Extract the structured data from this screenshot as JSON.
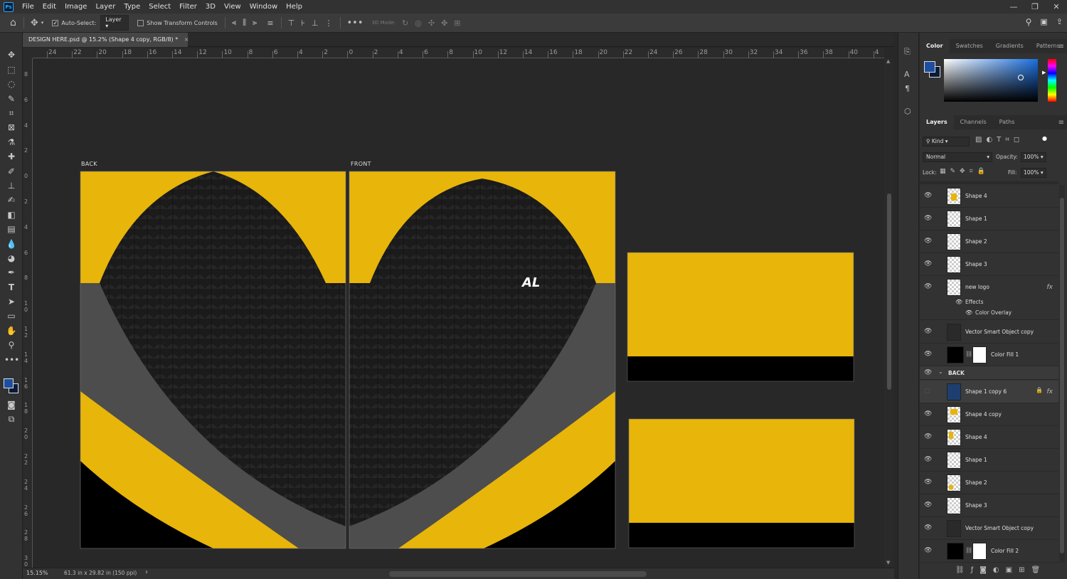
{
  "menu": [
    "File",
    "Edit",
    "Image",
    "Layer",
    "Type",
    "Select",
    "Filter",
    "3D",
    "View",
    "Window",
    "Help"
  ],
  "window_controls": [
    "—",
    "❐",
    "✕"
  ],
  "options": {
    "auto_select_label": "Auto-Select:",
    "auto_select_value": "Layer",
    "transform_label": "Show Transform Controls",
    "mode_3d_label": "3D Mode:"
  },
  "document": {
    "tab_title": "DESIGN HERE.psd @ 15.2% (Shape 4 copy, RGB/8) *",
    "close": "×"
  },
  "ruler_h_ticks": [
    "24",
    "22",
    "20",
    "18",
    "16",
    "14",
    "12",
    "10",
    "8",
    "6",
    "4",
    "2",
    "0",
    "2",
    "4",
    "6",
    "8",
    "10",
    "12",
    "14",
    "16",
    "18",
    "20",
    "22",
    "24",
    "26",
    "28",
    "30",
    "32",
    "34",
    "36",
    "38",
    "40",
    "4"
  ],
  "ruler_v_ticks": [
    "8",
    "6",
    "4",
    "2",
    "0",
    "2",
    "4",
    "6",
    "8",
    "1\n0",
    "1\n2",
    "1\n4",
    "1\n6",
    "1\n8",
    "2\n0",
    "2\n2",
    "2\n4",
    "2\n6",
    "2\n8",
    "3\n0"
  ],
  "canvas": {
    "back_label": "BACK",
    "front_label": "FRONT",
    "logo_text": "AL"
  },
  "status": {
    "zoom": "15.15%",
    "dimensions": "61.3 in x 29.82 in (150 ppi)",
    "arrow": "›"
  },
  "color_panel": {
    "tabs": [
      "Color",
      "Swatches",
      "Gradients",
      "Patterns"
    ],
    "fg": "#1e4ea0",
    "bg": "#0a1a3a"
  },
  "layers_panel": {
    "tabs": [
      "Layers",
      "Channels",
      "Paths"
    ],
    "kind_label": "Kind",
    "blend_mode": "Normal",
    "opacity_label": "Opacity:",
    "opacity_value": "100%",
    "lock_label": "Lock:",
    "fill_label": "Fill:",
    "fill_value": "100%",
    "layers": [
      {
        "name": "Shape 4",
        "fx": "",
        "thumb": "#e8b50a"
      },
      {
        "name": "Shape 1",
        "fx": "",
        "thumb": ""
      },
      {
        "name": "Shape 2",
        "fx": "",
        "thumb": ""
      },
      {
        "name": "Shape 3",
        "fx": "",
        "thumb": ""
      },
      {
        "name": "new logo",
        "fx": "fx",
        "thumb": ""
      }
    ],
    "effects_label": "Effects",
    "color_overlay_label": "Color Overlay",
    "layers2": [
      {
        "name": "Vector Smart Object copy",
        "fx": ""
      },
      {
        "name": "Color Fill 1",
        "fx": ""
      }
    ],
    "group_name": "BACK",
    "layers3": [
      {
        "name": "Shape 1 copy 6",
        "fx": "fx"
      },
      {
        "name": "Shape 4 copy",
        "fx": ""
      },
      {
        "name": "Shape 4",
        "fx": ""
      },
      {
        "name": "Shape 1",
        "fx": ""
      },
      {
        "name": "Shape 2",
        "fx": ""
      },
      {
        "name": "Shape 3",
        "fx": ""
      },
      {
        "name": "Vector Smart Object copy",
        "fx": ""
      },
      {
        "name": "Color Fill 2",
        "fx": ""
      }
    ]
  },
  "colors": {
    "yellow": "#e8b50a",
    "black": "#000000",
    "gray": "#4d4d4d",
    "dark": "#1a1a1a"
  }
}
